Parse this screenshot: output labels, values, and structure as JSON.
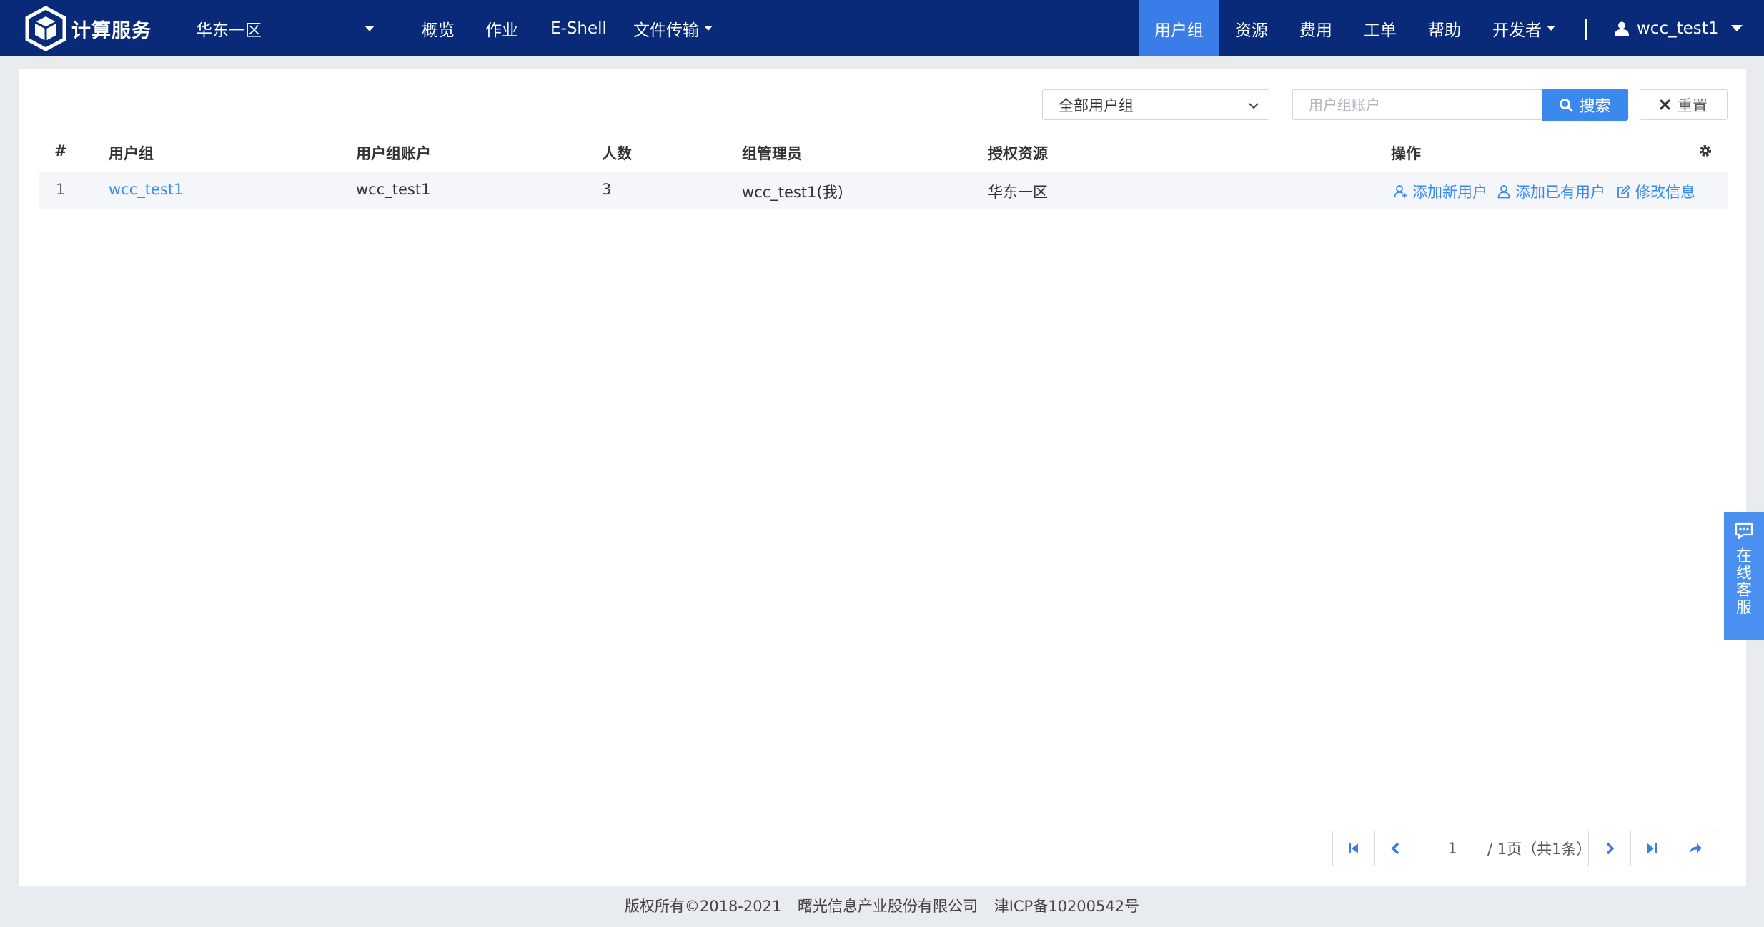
{
  "header": {
    "logo_text": "计算服务",
    "region": "华东一区",
    "nav": {
      "overview": "概览",
      "jobs": "作业",
      "eshell": "E-Shell",
      "file_transfer": "文件传输",
      "user_group": "用户组",
      "resources": "资源",
      "billing": "费用",
      "tickets": "工单",
      "help": "帮助",
      "developer": "开发者"
    },
    "username": "wcc_test1"
  },
  "filters": {
    "group_select": "全部用户组",
    "search_placeholder": "用户组账户",
    "search_label": "搜索",
    "reset_label": "重置"
  },
  "table": {
    "headers": {
      "index": "#",
      "group": "用户组",
      "account": "用户组账户",
      "count": "人数",
      "admin": "组管理员",
      "resources": "授权资源",
      "actions": "操作"
    },
    "rows": [
      {
        "index": "1",
        "group": "wcc_test1",
        "account": "wcc_test1",
        "count": "3",
        "admin": "wcc_test1(我)",
        "resources": "华东一区",
        "actions": {
          "add_new_user": "添加新用户",
          "add_existing_user": "添加已有用户",
          "edit_info": "修改信息"
        }
      }
    ]
  },
  "pagination": {
    "current_page": "1",
    "info": "/ 1页（共1条）"
  },
  "footer": {
    "copyright": "版权所有©2018-2021",
    "company": "曙光信息产业股份有限公司",
    "icp": "津ICP备10200542号"
  },
  "service_tab": {
    "label": "在线客服"
  },
  "colors": {
    "header_bg": "#082a78",
    "active_nav": "#3a7ce8",
    "accent": "#3a89ee"
  }
}
